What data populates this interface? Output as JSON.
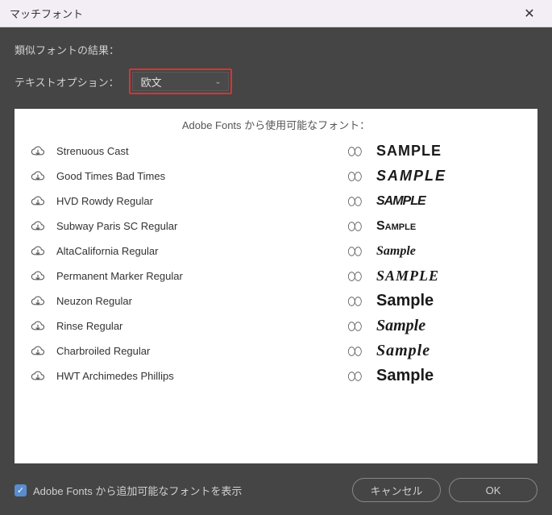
{
  "titlebar": {
    "title": "マッチフォント"
  },
  "header": {
    "result_label": "類似フォントの結果：",
    "option_label": "テキストオプション：",
    "dropdown_value": "欧文"
  },
  "panel": {
    "header": "Adobe Fonts から使用可能なフォント：",
    "sample_text": "SAMPLE",
    "fonts": [
      {
        "name": "Strenuous Cast",
        "sample": "SAMPLE"
      },
      {
        "name": "Good Times Bad Times",
        "sample": "SAMPLE"
      },
      {
        "name": "HVD Rowdy Regular",
        "sample": "SAMPLE"
      },
      {
        "name": "Subway Paris SC Regular",
        "sample": "Sample"
      },
      {
        "name": "AltaCalifornia Regular",
        "sample": "Sample"
      },
      {
        "name": "Permanent Marker Regular",
        "sample": "SAMPLE"
      },
      {
        "name": "Neuzon Regular",
        "sample": "Sample"
      },
      {
        "name": "Rinse Regular",
        "sample": "Sample"
      },
      {
        "name": "Charbroiled Regular",
        "sample": "Sample"
      },
      {
        "name": "HWT Archimedes Phillips",
        "sample": "Sample"
      }
    ]
  },
  "footer": {
    "checkbox_label": "Adobe Fonts から追加可能なフォントを表示",
    "cancel_label": "キャンセル",
    "ok_label": "OK"
  }
}
